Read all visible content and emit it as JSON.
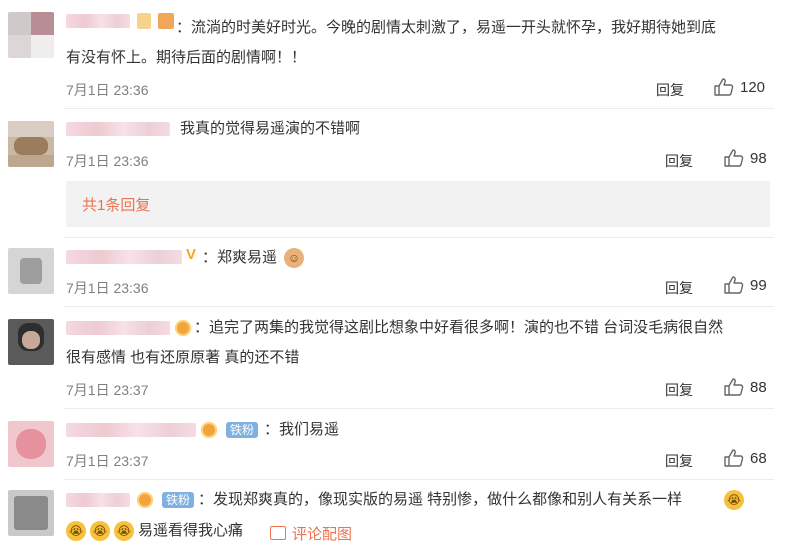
{
  "comments": [
    {
      "text_lines": [
        "：流淌的时美好时光。今晚的剧情太刺激了，易遥一开头就怀孕，我好期待她到底",
        "有没有怀上。期待后面的剧情啊！！"
      ],
      "time": "7月1日 23:36",
      "reply": "回复",
      "likes": "120"
    },
    {
      "text_lines": [
        "我真的觉得易遥演的不错啊"
      ],
      "time": "7月1日 23:36",
      "reply": "回复",
      "likes": "98",
      "sub_reply": "共1条回复"
    },
    {
      "text_lines": [
        "：郑爽易遥"
      ],
      "time": "7月1日 23:36",
      "reply": "回复",
      "likes": "99"
    },
    {
      "text_lines": [
        "：追完了两集的我觉得这剧比想象中好看很多啊！演的也不错 台词没毛病很自然",
        "很有感情 也有还原原著 真的还不错"
      ],
      "time": "7月1日 23:37",
      "reply": "回复",
      "likes": "88"
    },
    {
      "text_lines": [
        "：我们易遥"
      ],
      "time": "7月1日 23:37",
      "reply": "回复",
      "likes": "68",
      "badge": "铁粉"
    },
    {
      "text_lines": [
        "：发现郑爽真的，像现实版的易遥 特别惨，做什么都像和别人有关系一样",
        "易遥看得我心痛"
      ],
      "badge": "铁粉",
      "pic_link": "评论配图"
    }
  ],
  "icons": {
    "like": "thumbs-up-icon",
    "crying": "crying-emoji-icon",
    "picture": "picture-icon",
    "verified": "vip-v-icon"
  },
  "colors": {
    "link": "#eb7350",
    "time": "#808080",
    "badge": "#7fb0e0"
  }
}
